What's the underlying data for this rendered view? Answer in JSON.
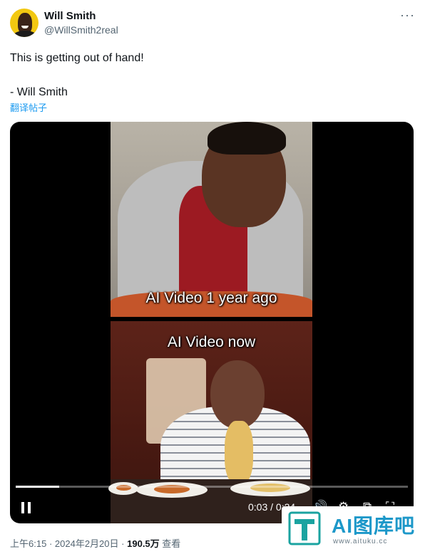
{
  "author": {
    "name": "Will Smith",
    "handle": "@WillSmith2real",
    "avatar_icon": "avatar-photo"
  },
  "more_icon": "more-dots-icon",
  "tweet": {
    "line1": "This is getting out of hand!",
    "line2": "- Will Smith",
    "translate_label": "翻译帖子"
  },
  "video": {
    "caption_top": "AI Video 1 year ago",
    "caption_bottom": "AI Video now",
    "current_time": "0:03",
    "separator": "/",
    "total_time": "0:24",
    "progress": 0.11,
    "state": "playing"
  },
  "footer": {
    "time": "上午6:15",
    "dot": "·",
    "date": "2024年2月20日",
    "views": "190.5万",
    "views_label": "查看"
  },
  "watermark": {
    "text": "AI图库吧",
    "url": "www.aituku.cc",
    "color": "#1d98c9"
  },
  "colors": {
    "accent": "#1d9bf0",
    "secondary_text": "#536471"
  }
}
